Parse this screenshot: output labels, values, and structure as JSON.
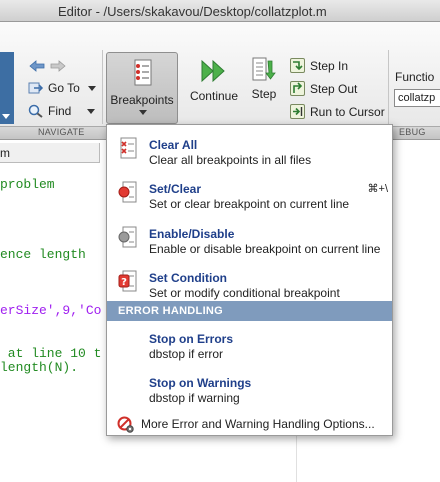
{
  "window": {
    "title": "Editor - /Users/skakavou/Desktop/collatzplot.m"
  },
  "toolstrip": {
    "navigate": {
      "goto_label": "Go To",
      "find_label": "Find",
      "section_label": "NAVIGATE"
    },
    "breakpoints_label": "Breakpoints",
    "continue_label": "Continue",
    "step_label": "Step",
    "step_in_label": "Step In",
    "step_out_label": "Step Out",
    "run_to_cursor_label": "Run to Cursor",
    "function_label": "Functio",
    "function_value": "collatzp",
    "debug_section_label": "EBUG"
  },
  "editor": {
    "tab_label": "m",
    "lines": [
      {
        "text": "problem",
        "color": "green"
      },
      {
        "text": "ence length",
        "color": "green"
      },
      {
        "text": "erSize',9,'Co",
        "color": "purple"
      },
      {
        "text": " at line 10 t",
        "color": "green"
      },
      {
        "text": "length(N).",
        "color": "green"
      }
    ]
  },
  "menu": {
    "items": [
      {
        "title": "Clear All",
        "desc": "Clear all breakpoints in all files",
        "shortcut": "",
        "icon": "clear-all-breakpoints-icon"
      },
      {
        "title": "Set/Clear",
        "desc": "Set or clear breakpoint on current line",
        "shortcut": "⌘+\\",
        "icon": "set-clear-breakpoint-icon"
      },
      {
        "title": "Enable/Disable",
        "desc": "Enable or disable breakpoint on current line",
        "shortcut": "",
        "icon": "enable-disable-breakpoint-icon"
      },
      {
        "title": "Set Condition",
        "desc": "Set or modify conditional breakpoint",
        "shortcut": "",
        "icon": "conditional-breakpoint-icon"
      }
    ],
    "error_header": "ERROR HANDLING",
    "error_items": [
      {
        "title": "Stop on Errors",
        "desc": "dbstop if error"
      },
      {
        "title": "Stop on Warnings",
        "desc": "dbstop if warning"
      }
    ],
    "options_label": "More Error and Warning Handling Options..."
  },
  "colors": {
    "accent_blue": "#1f3f8a",
    "header_blue": "#7f9bbd",
    "code_green": "#228b22",
    "code_purple": "#a020f0"
  }
}
